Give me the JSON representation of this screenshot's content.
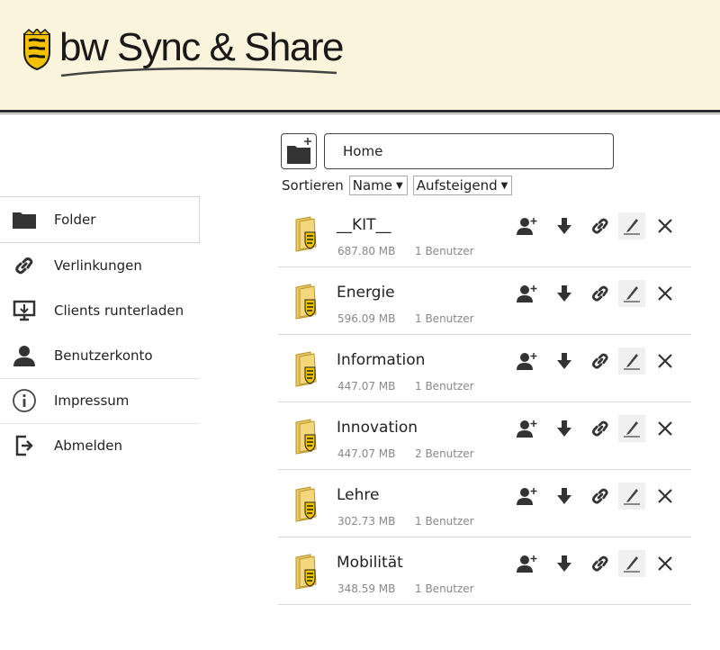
{
  "header": {
    "logo_text": "bw Sync & Share",
    "colors": {
      "background": "#fbf4dc",
      "rule": "#2a2a2a"
    }
  },
  "sidebar": {
    "items": [
      {
        "label": "Folder",
        "icon": "folder-icon",
        "active": true
      },
      {
        "label": "Verlinkungen",
        "icon": "link-icon"
      },
      {
        "label": "Clients runterladen",
        "icon": "desktop-download-icon"
      },
      {
        "label": "Benutzerkonto",
        "icon": "user-icon"
      },
      {
        "label": "Impressum",
        "icon": "info-icon"
      },
      {
        "label": "Abmelden",
        "icon": "logout-icon"
      }
    ]
  },
  "toolbar": {
    "new_folder_icon": "new-folder-icon",
    "path": "Home",
    "sort_label": "Sortieren",
    "sort_by": "Name",
    "sort_order": "Aufsteigend"
  },
  "files": [
    {
      "name": "__KIT__",
      "size": "687.80 MB",
      "users": "1 Benutzer"
    },
    {
      "name": "Energie",
      "size": "596.09 MB",
      "users": "1 Benutzer"
    },
    {
      "name": "Information",
      "size": "447.07 MB",
      "users": "1 Benutzer"
    },
    {
      "name": "Innovation",
      "size": "447.07 MB",
      "users": "2 Benutzer"
    },
    {
      "name": "Lehre",
      "size": "302.73 MB",
      "users": "1 Benutzer"
    },
    {
      "name": "Mobilität",
      "size": "348.59 MB",
      "users": "1 Benutzer"
    }
  ],
  "row_actions": [
    "share-user-icon",
    "download-icon",
    "link-icon",
    "edit-icon",
    "delete-icon"
  ]
}
